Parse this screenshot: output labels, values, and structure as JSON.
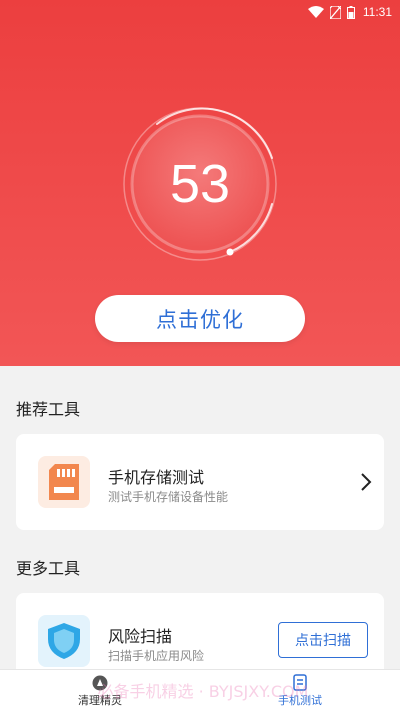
{
  "status_bar": {
    "time": "11:31"
  },
  "score": {
    "value": "53"
  },
  "optimize_button": {
    "label": "点击优化"
  },
  "recommended": {
    "title": "推荐工具",
    "card": {
      "title": "手机存储测试",
      "subtitle": "测试手机存储设备性能"
    }
  },
  "more": {
    "title": "更多工具",
    "card": {
      "title": "风险扫描",
      "subtitle": "扫描手机应用风险",
      "button": "点击扫描"
    }
  },
  "bottom_nav": {
    "items": [
      {
        "label": "清理精灵"
      },
      {
        "label": "手机测试"
      }
    ]
  },
  "watermark": "必备手机精选 · BYJSJXY.COM",
  "colors": {
    "hero": "#ec3f3f",
    "accent": "#2f6fd6",
    "storage_icon": "#f2874e",
    "shield_icon": "#2ea7e6"
  }
}
